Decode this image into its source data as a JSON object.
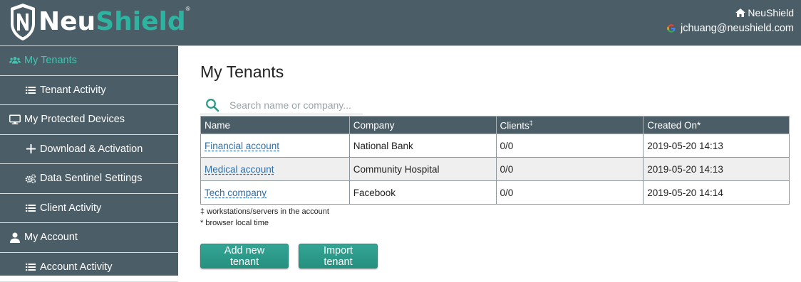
{
  "header": {
    "logo_text_neu": "Neu",
    "logo_text_shield": "Shield",
    "logo_reg": "®",
    "home_label": "NeuShield",
    "user_email": "jchuang@neushield.com",
    "brand_color": "#4b5e68",
    "accent_color": "#2db3a0"
  },
  "sidebar": {
    "items": [
      {
        "label": "My Tenants",
        "icon": "users-icon",
        "active": true
      },
      {
        "label": "Tenant Activity",
        "icon": "list-icon"
      },
      {
        "label": "My Protected Devices",
        "icon": "monitor-icon"
      },
      {
        "label": "Download & Activation",
        "icon": "plus-icon"
      },
      {
        "label": "Data Sentinel Settings",
        "icon": "cogs-icon"
      },
      {
        "label": "Client Activity",
        "icon": "list-icon"
      },
      {
        "label": "My Account",
        "icon": "user-icon"
      },
      {
        "label": "Account Activity",
        "icon": "list-icon"
      }
    ]
  },
  "main": {
    "title": "My Tenants",
    "search": {
      "placeholder": "Search name or company...",
      "value": ""
    },
    "table": {
      "headers": {
        "name": "Name",
        "company": "Company",
        "clients": "Clients",
        "clients_sup": "‡",
        "created": "Created On*"
      },
      "rows": [
        {
          "name": "Financial account",
          "company": "National Bank",
          "clients": "0/0",
          "created": "2019-05-20 14:13"
        },
        {
          "name": "Medical account",
          "company": "Community Hospital",
          "clients": "0/0",
          "created": "2019-05-20 14:13"
        },
        {
          "name": "Tech company",
          "company": "Facebook",
          "clients": "0/0",
          "created": "2019-05-20 14:14"
        }
      ]
    },
    "notes": {
      "clients_note": "‡ workstations/servers in the account",
      "time_note": "* browser local time"
    },
    "buttons": {
      "add": "Add new tenant",
      "import": "Import tenant"
    }
  }
}
